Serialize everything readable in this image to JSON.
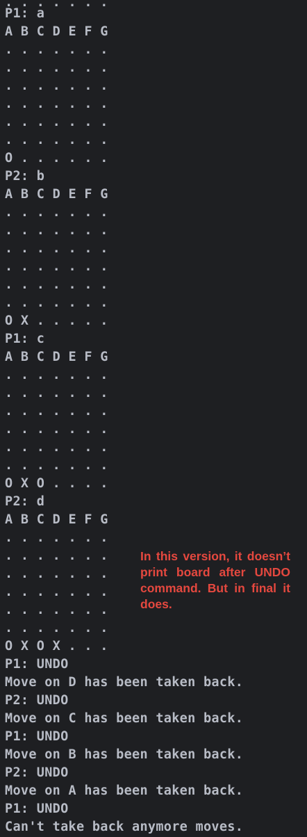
{
  "terminal": {
    "lines": [
      ". . . . . . .",
      "P1: a",
      "A B C D E F G",
      ". . . . . . .",
      ". . . . . . .",
      ". . . . . . .",
      ". . . . . . .",
      ". . . . . . .",
      ". . . . . . .",
      "O . . . . . .",
      "P2: b",
      "A B C D E F G",
      ". . . . . . .",
      ". . . . . . .",
      ". . . . . . .",
      ". . . . . . .",
      ". . . . . . .",
      ". . . . . . .",
      "O X . . . . .",
      "P1: c",
      "A B C D E F G",
      ". . . . . . .",
      ". . . . . . .",
      ". . . . . . .",
      ". . . . . . .",
      ". . . . . . .",
      ". . . . . . .",
      "O X O . . . .",
      "P2: d",
      "A B C D E F G",
      ". . . . . . .",
      ". . . . . . .",
      ". . . . . . .",
      ". . . . . . .",
      ". . . . . . .",
      ". . . . . . .",
      "O X O X . . .",
      "P1: UNDO",
      "Move on D has been taken back.",
      "P2: UNDO",
      "Move on C has been taken back.",
      "P1: UNDO",
      "Move on B has been taken back.",
      "P2: UNDO",
      "Move on A has been taken back.",
      "P1: UNDO",
      "Can't take back anymore moves."
    ]
  },
  "annotation": {
    "text": "In this version, it doesn’t print board after UNDO command. But in final it does."
  },
  "colors": {
    "background": "#1e1f22",
    "text": "#b8bcc6",
    "annotation": "#e5483f"
  }
}
